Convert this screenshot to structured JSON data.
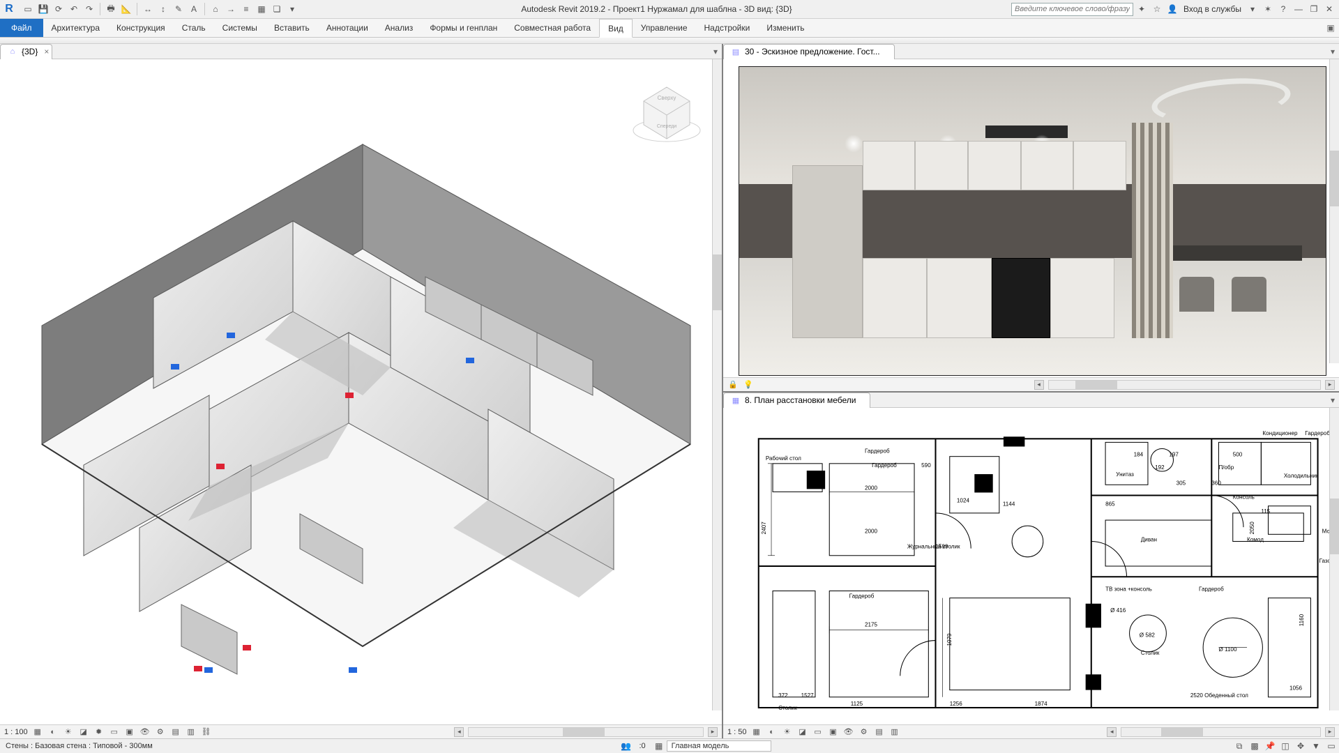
{
  "app": {
    "title": "Autodesk Revit 2019.2 - Проект1 Нуржамал для шаблна - 3D вид: {3D}",
    "search_placeholder": "Введите ключевое слово/фразу",
    "signin": "Вход в службы"
  },
  "ribbon": {
    "file": "Файл",
    "tabs": [
      "Архитектура",
      "Конструкция",
      "Сталь",
      "Системы",
      "Вставить",
      "Аннотации",
      "Анализ",
      "Формы и генплан",
      "Совместная работа",
      "Вид",
      "Управление",
      "Надстройки",
      "Изменить"
    ],
    "active": "Вид"
  },
  "views": {
    "left_tab": "{3D}",
    "right_top_tab": "30 - Эскизное предложение. Гост...",
    "right_bot_tab": "8. План расстановки мебели"
  },
  "vcb": {
    "left_scale": "1 : 100",
    "right_scale": "1 : 50"
  },
  "status": {
    "hint": "Стены : Базовая стена : Типовой - 300мм",
    "main_model": "Главная модель",
    "zero": ":0"
  },
  "viewcube": {
    "face_top": "Сверху",
    "face_front": "Спереди"
  },
  "floorplan_labels": {
    "rabochy_stol": "Рабочий стол",
    "garderob": "Гардероб",
    "stolik": "Столик",
    "zhurnalny_stolik": "Журнальный столик",
    "unitaz": "Унитаз",
    "kholodilnik": "Холодильник",
    "konsol": "Консоль",
    "moyka": "Мойка",
    "divan": "Диван",
    "komod": "Комод",
    "gaz_plita": "Газовая плита с духовкой",
    "tv_zona": "ТВ зона +консоль",
    "obedenny_stol": "Обеденный стол",
    "kondicioner": "Кондиционер",
    "polka": "П/обр"
  },
  "floorplan_dims": [
    "2000",
    "2000",
    "2175",
    "1125",
    "1256",
    "1874",
    "1079",
    "1599",
    "1024",
    "590",
    "2407",
    "372",
    "1527",
    "2520",
    "2050",
    "1160",
    "1056",
    "360",
    "305",
    "115",
    "865",
    "184",
    "192",
    "500",
    "1144",
    "197",
    "Ø 582",
    "Ø 416",
    "Ø 1100"
  ]
}
